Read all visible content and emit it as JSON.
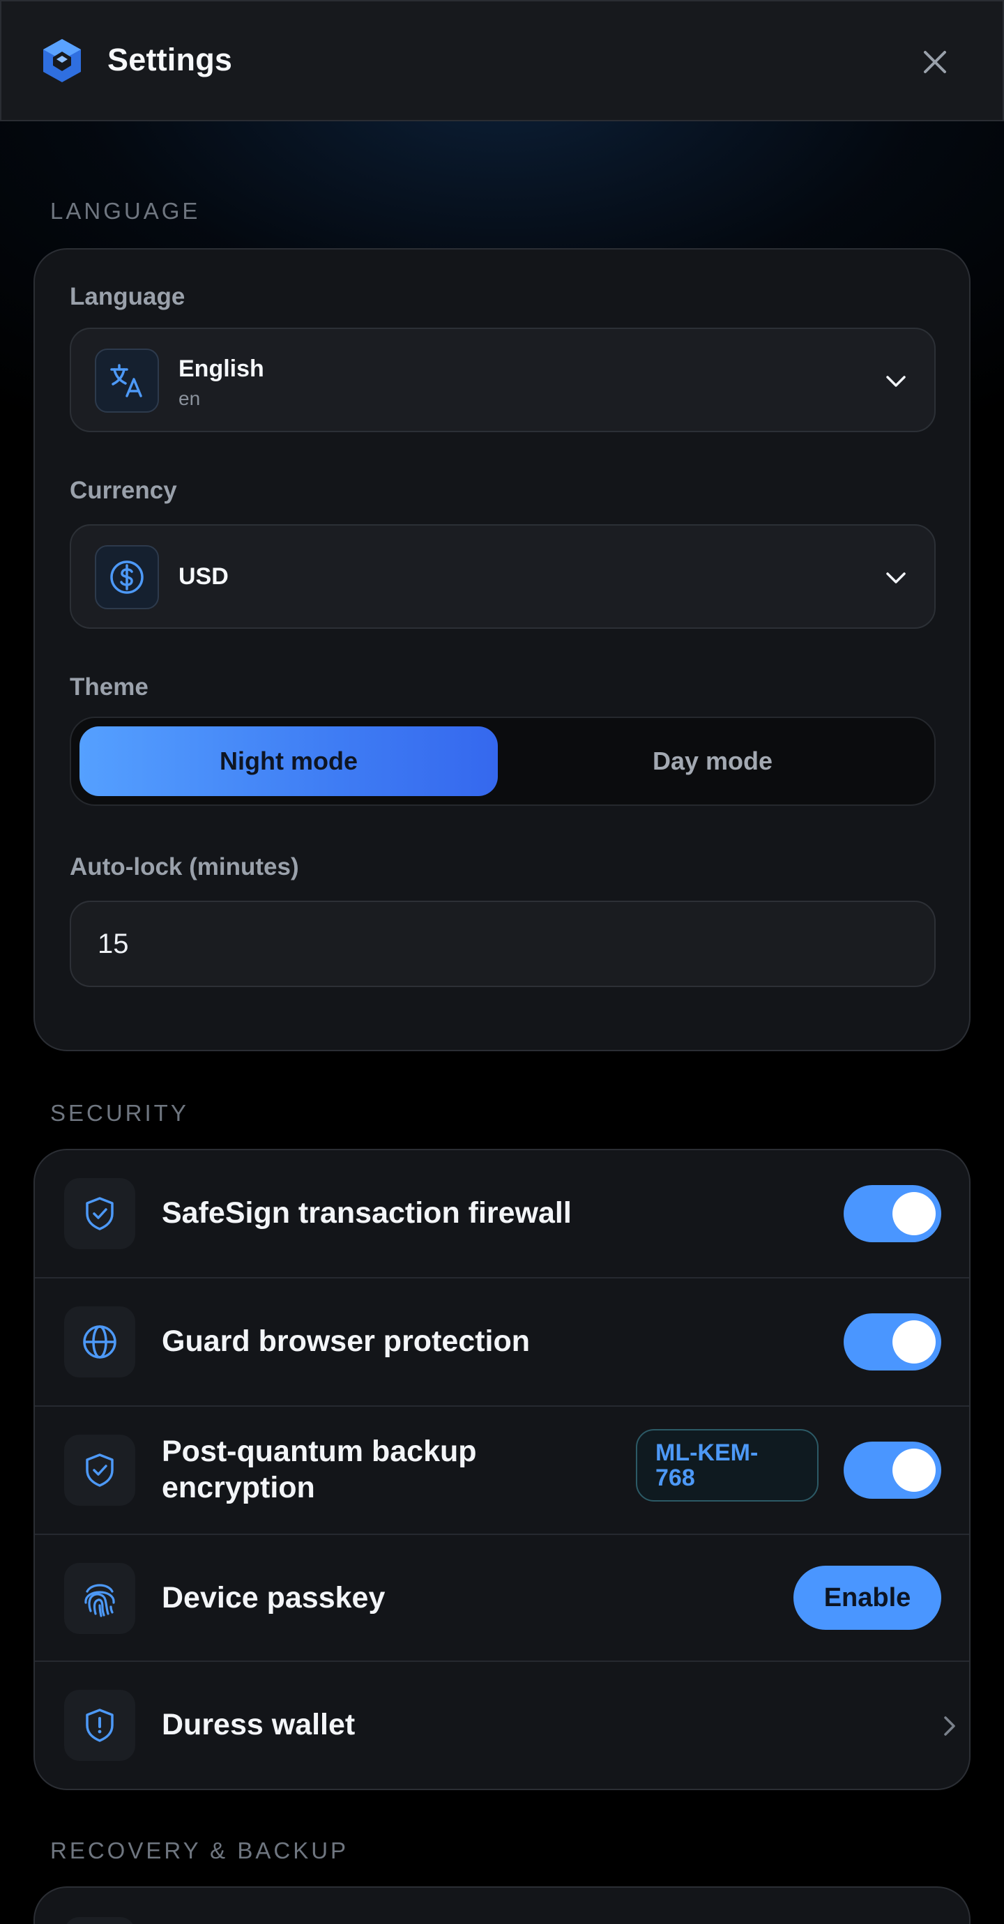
{
  "header": {
    "title": "Settings",
    "logo_icon": "app-logo-icon",
    "close_icon": "close-icon"
  },
  "sections": {
    "language_label": "LANGUAGE",
    "security_label": "SECURITY",
    "recovery_label": "RECOVERY & BACKUP"
  },
  "language_card": {
    "language": {
      "label": "Language",
      "icon": "translate-icon",
      "selected_name": "English",
      "selected_code": "en"
    },
    "currency": {
      "label": "Currency",
      "icon": "dollar-circle-icon",
      "selected": "USD"
    },
    "theme": {
      "label": "Theme",
      "options": [
        "Night mode",
        "Day mode"
      ],
      "selected": "Night mode"
    },
    "auto_lock": {
      "label": "Auto-lock (minutes)",
      "value": "15"
    }
  },
  "security": {
    "items": [
      {
        "label": "SafeSign transaction firewall",
        "icon": "shield-check-icon",
        "control": "toggle",
        "enabled": true
      },
      {
        "label": "Guard browser protection",
        "icon": "globe-icon",
        "control": "toggle",
        "enabled": true
      },
      {
        "label_line1": "Post-quantum backup",
        "label_line2": "encryption",
        "icon": "shield-check-icon",
        "badge_line1": "ML-KEM-",
        "badge_line2": "768",
        "control": "toggle",
        "enabled": true
      },
      {
        "label": "Device passkey",
        "icon": "fingerprint-icon",
        "control": "button",
        "button_label": "Enable"
      },
      {
        "label": "Duress wallet",
        "icon": "shield-alert-icon",
        "control": "chevron"
      }
    ]
  },
  "colors": {
    "accent": "#4a96ff",
    "card_bg": "#131519",
    "page_bg": "#000000"
  }
}
